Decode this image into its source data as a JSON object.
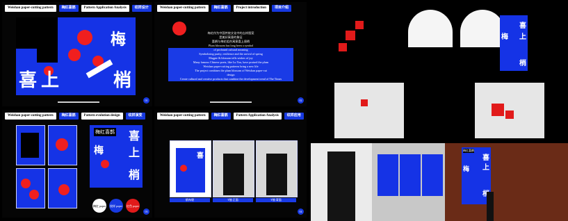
{
  "panels": {
    "p1": {
      "tabs": [
        "Weishan paper-cutting pattern",
        "梅红喜鹊",
        "Pattern Application Analysis",
        "纹样设计"
      ],
      "chars": [
        "梅",
        "喜",
        "上",
        "梢"
      ],
      "page": "01"
    },
    "p2": {
      "tabs": [
        "Weishan paper-cutting pattern",
        "梅红喜鹊",
        "Project introduction",
        "项目介绍"
      ],
      "page": "02",
      "intro_lines": [
        "梅花作为中国传统文化中的吉祥图案",
        "是美好寓意的象征",
        "喜鹊与梅花组合寓意喜上眉梢",
        "Plum blossom has long been a symbol",
        "of profound cultural meaning",
        "Symbolizing purity, resilience and the arrival of spring",
        "Magpie & blossom tells wishes of joy",
        "Many famous Chinese poets, like Lu You, have praised the plum",
        "Weishan paper-cutting patterns bring a new life",
        "The project combines the plum blossom of Weishan paper-cut",
        "design",
        "Create cultural and creative products that combine the development trend of The Times"
      ]
    },
    "p3": {
      "tabs": [
        "Weishan paper-cutting pattern",
        "梅红喜鹊",
        "Pattern evolution design",
        "纹样演变"
      ],
      "poster_title": "梅红喜鹊",
      "chars": [
        "喜",
        "上",
        "梢",
        "梅"
      ],
      "buttons": [
        "梅红 paper",
        "纹样 paper",
        "红色 paper"
      ],
      "page": "03"
    },
    "p4": {
      "tabs": [
        "Weishan paper-cutting pattern",
        "梅红喜鹊",
        "Pattern Application Analysis",
        "纹样应用"
      ],
      "captions": [
        "帆布袋",
        "T恤 正面",
        "T恤 背面"
      ],
      "chars": [
        "喜",
        "上",
        "梢"
      ],
      "page": "04"
    }
  },
  "mockups": {
    "bag_chars": [
      "梅",
      "喜",
      "上",
      "梢"
    ],
    "poster_title": "梅红喜鹊",
    "poster_chars": [
      "梅",
      "喜",
      "上",
      "梢"
    ]
  }
}
